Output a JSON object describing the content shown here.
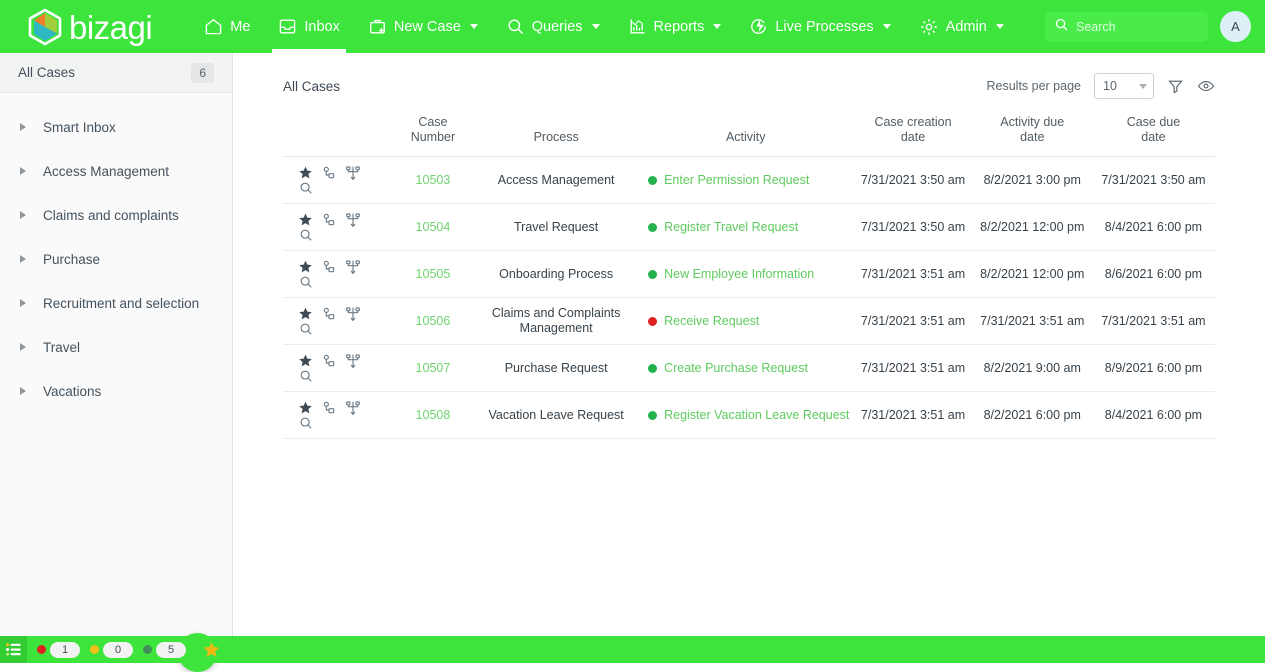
{
  "header": {
    "brand": "bizagi",
    "brand_logo_icon": "bizagi-hexagon-logo",
    "nav": [
      {
        "label": "Me",
        "icon": "home-icon",
        "caret": false,
        "active": false
      },
      {
        "label": "Inbox",
        "icon": "inbox-tray-icon",
        "caret": false,
        "active": true
      },
      {
        "label": "New Case",
        "icon": "briefcase-plus-icon",
        "caret": true,
        "active": false
      },
      {
        "label": "Queries",
        "icon": "search-icon",
        "caret": true,
        "active": false
      },
      {
        "label": "Reports",
        "icon": "bar-chart-icon",
        "caret": true,
        "active": false
      },
      {
        "label": "Live Processes",
        "icon": "lightning-circle-icon",
        "caret": true,
        "active": false
      },
      {
        "label": "Admin",
        "icon": "gear-icon",
        "caret": true,
        "active": false
      }
    ],
    "search": {
      "value": "",
      "placeholder": "Search",
      "icon": "search-icon"
    },
    "avatar_initial": "A",
    "bar_color": "#3ce43c"
  },
  "sidebar": {
    "header": {
      "title": "All Cases",
      "count": "6"
    },
    "items": [
      {
        "label": "Smart Inbox"
      },
      {
        "label": "Access Management"
      },
      {
        "label": "Claims and complaints"
      },
      {
        "label": "Purchase"
      },
      {
        "label": "Recruitment and selection"
      },
      {
        "label": "Travel"
      },
      {
        "label": "Vacations"
      }
    ],
    "fab": {
      "icon": "new-case-briefcase-plus-icon",
      "color": "#3ce43c"
    }
  },
  "main": {
    "page_title": "All Cases",
    "toolbar": {
      "results_per_page_label": "Results per page",
      "results_per_page_value": "10",
      "filter_icon": "funnel-filter-icon",
      "visibility_icon": "eye-icon"
    },
    "table": {
      "columns": [
        {
          "key": "icons",
          "label": ""
        },
        {
          "key": "case",
          "label": "Case\nNumber"
        },
        {
          "key": "process",
          "label": "Process"
        },
        {
          "key": "activity",
          "label": "Activity"
        },
        {
          "key": "created",
          "label": "Case creation\ndate"
        },
        {
          "key": "actdue",
          "label": "Activity due\ndate"
        },
        {
          "key": "casedue",
          "label": "Case due\ndate"
        }
      ],
      "row_icons": [
        "star-icon",
        "magnifier-icon",
        "related-cases-icon",
        "process-diagram-icon"
      ],
      "rows": [
        {
          "case_number": "10503",
          "process": "Access Management",
          "activity": "Enter Permission Request",
          "status_color": "#22b14c",
          "case_creation_date": "7/31/2021 3:50 am",
          "activity_due_date": "8/2/2021 3:00 pm",
          "case_due_date": "7/31/2021 3:50 am"
        },
        {
          "case_number": "10504",
          "process": "Travel Request",
          "activity": "Register Travel Request",
          "status_color": "#22b14c",
          "case_creation_date": "7/31/2021 3:50 am",
          "activity_due_date": "8/2/2021 12:00 pm",
          "case_due_date": "8/4/2021 6:00 pm"
        },
        {
          "case_number": "10505",
          "process": "Onboarding Process",
          "activity": "New Employee Information",
          "status_color": "#22b14c",
          "case_creation_date": "7/31/2021 3:51 am",
          "activity_due_date": "8/2/2021 12:00 pm",
          "case_due_date": "8/6/2021 6:00 pm"
        },
        {
          "case_number": "10506",
          "process": "Claims and Complaints Management",
          "activity": "Receive Request",
          "status_color": "#e02020",
          "case_creation_date": "7/31/2021 3:51 am",
          "activity_due_date": "7/31/2021 3:51 am",
          "case_due_date": "7/31/2021 3:51 am"
        },
        {
          "case_number": "10507",
          "process": "Purchase Request",
          "activity": "Create Purchase Request",
          "status_color": "#22b14c",
          "case_creation_date": "7/31/2021 3:51 am",
          "activity_due_date": "8/2/2021 9:00 am",
          "case_due_date": "8/9/2021 6:00 pm"
        },
        {
          "case_number": "10508",
          "process": "Vacation Leave Request",
          "activity": "Register Vacation Leave Request",
          "status_color": "#22b14c",
          "case_creation_date": "7/31/2021 3:51 am",
          "activity_due_date": "8/2/2021 6:00 pm",
          "case_due_date": "8/4/2021 6:00 pm"
        }
      ]
    }
  },
  "statusbar": {
    "toggle_icon": "list-toggle-icon",
    "counters": [
      {
        "label": "1",
        "color": "#e02020",
        "name": "overdue"
      },
      {
        "label": "0",
        "color": "#f2c018",
        "name": "at-risk"
      },
      {
        "label": "5",
        "color": "#3f8f5a",
        "name": "on-time"
      }
    ],
    "star_icon": "favorites-star-icon",
    "star_color": "#f2b713"
  }
}
